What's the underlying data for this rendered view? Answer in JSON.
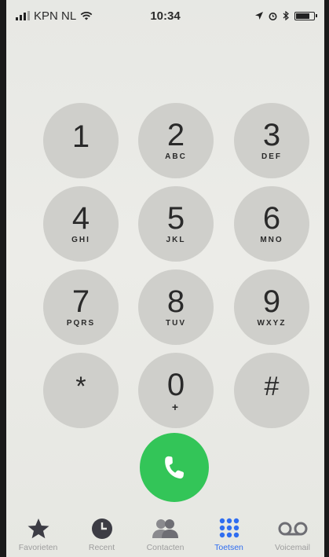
{
  "status_bar": {
    "carrier": "KPN NL",
    "time": "10:34",
    "battery_level": 0.8
  },
  "keypad": {
    "keys": [
      {
        "digit": "1",
        "letters": ""
      },
      {
        "digit": "2",
        "letters": "ABC"
      },
      {
        "digit": "3",
        "letters": "DEF"
      },
      {
        "digit": "4",
        "letters": "GHI"
      },
      {
        "digit": "5",
        "letters": "JKL"
      },
      {
        "digit": "6",
        "letters": "MNO"
      },
      {
        "digit": "7",
        "letters": "PQRS"
      },
      {
        "digit": "8",
        "letters": "TUV"
      },
      {
        "digit": "9",
        "letters": "WXYZ"
      },
      {
        "digit": "*",
        "letters": ""
      },
      {
        "digit": "0",
        "letters": "+"
      },
      {
        "digit": "#",
        "letters": ""
      }
    ]
  },
  "call_button": {
    "icon": "phone-icon",
    "color": "#33c558"
  },
  "tab_bar": {
    "active_color": "#2f6df0",
    "tabs": [
      {
        "label": "Favorieten",
        "icon": "star-icon"
      },
      {
        "label": "Recent",
        "icon": "clock-icon"
      },
      {
        "label": "Contacten",
        "icon": "contacts-icon"
      },
      {
        "label": "Toetsen",
        "icon": "keypad-icon",
        "active": true
      },
      {
        "label": "Voicemail",
        "icon": "voicemail-icon"
      }
    ]
  }
}
